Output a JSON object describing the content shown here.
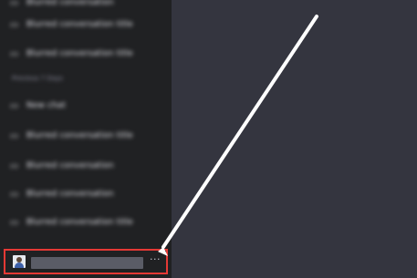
{
  "sidebar": {
    "section_label": "Previous 7 Days",
    "items": [
      {
        "label": "Blurred conversation",
        "icon": "chat-icon"
      },
      {
        "label": "Blurred conversation title",
        "icon": "chat-icon"
      },
      {
        "label": "Blurred conversation title",
        "icon": "chat-icon"
      },
      {
        "label": "New chat",
        "icon": "chat-icon"
      },
      {
        "label": "Blurred conversation title",
        "icon": "chat-icon"
      },
      {
        "label": "Blurred conversation",
        "icon": "chat-icon"
      },
      {
        "label": "Blurred conversation",
        "icon": "chat-icon"
      },
      {
        "label": "Blurred conversation title",
        "icon": "chat-icon"
      }
    ]
  },
  "footer": {
    "more_label": "···",
    "highlight_color": "#e53935"
  },
  "colors": {
    "sidebar_bg": "#202123",
    "main_bg": "#34353f",
    "annotation": "#ffffff"
  }
}
